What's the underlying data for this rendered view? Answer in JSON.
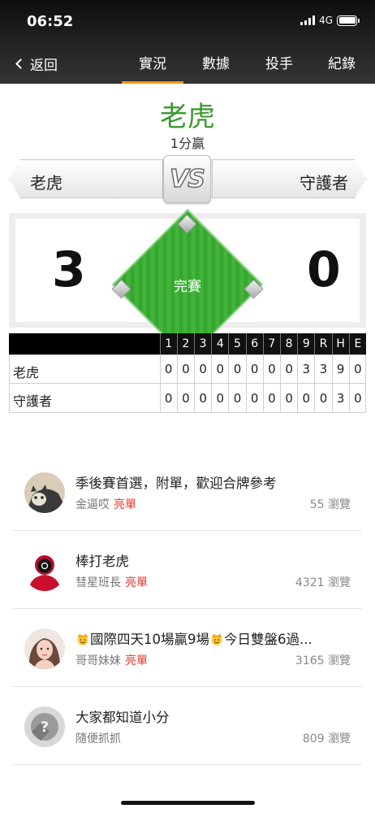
{
  "status_bar": {
    "time": "06:52",
    "network": "4G"
  },
  "nav": {
    "back_label": "返回",
    "tabs": [
      {
        "label": "實況",
        "active": true
      },
      {
        "label": "數據",
        "active": false
      },
      {
        "label": "投手",
        "active": false
      },
      {
        "label": "紀錄",
        "active": false
      }
    ]
  },
  "game": {
    "winner": "老虎",
    "margin_text": "1分贏",
    "away_team": "老虎",
    "home_team": "守護者",
    "vs_label": "VS",
    "away_score": "3",
    "home_score": "0",
    "status": "完賽"
  },
  "linescore": {
    "headers": [
      "1",
      "2",
      "3",
      "4",
      "5",
      "6",
      "7",
      "8",
      "9",
      "R",
      "H",
      "E"
    ],
    "rows": [
      {
        "team": "老虎",
        "cells": [
          "0",
          "0",
          "0",
          "0",
          "0",
          "0",
          "0",
          "0",
          "3",
          "3",
          "9",
          "0"
        ]
      },
      {
        "team": "守護者",
        "cells": [
          "0",
          "0",
          "0",
          "0",
          "0",
          "0",
          "0",
          "0",
          "0",
          "0",
          "3",
          "0"
        ]
      }
    ]
  },
  "posts": [
    {
      "title": "季後賽首選，附單，歡迎合牌參考",
      "author": "金逼哎",
      "badge": "亮單",
      "views": "55 瀏覽",
      "avatar": "avatar-cat"
    },
    {
      "title": "棒打老虎",
      "author": "彗星班長",
      "badge": "亮單",
      "views": "4321 瀏覽",
      "avatar": "avatar-person-red"
    },
    {
      "title": "國際四天10場贏9場",
      "title_mid": "今日雙盤6過...",
      "author": "哥哥妹妹",
      "badge": "亮單",
      "views": "3165 瀏覽",
      "avatar": "avatar-woman"
    },
    {
      "title": "大家都知道小分",
      "author": "隨便抓抓",
      "badge": "",
      "views": "809 瀏覽",
      "avatar": "avatar-default"
    }
  ],
  "colors": {
    "accent": "#f29a16",
    "winner": "#3b9a2f",
    "badge": "#e8352a",
    "field": "#35a72f"
  }
}
